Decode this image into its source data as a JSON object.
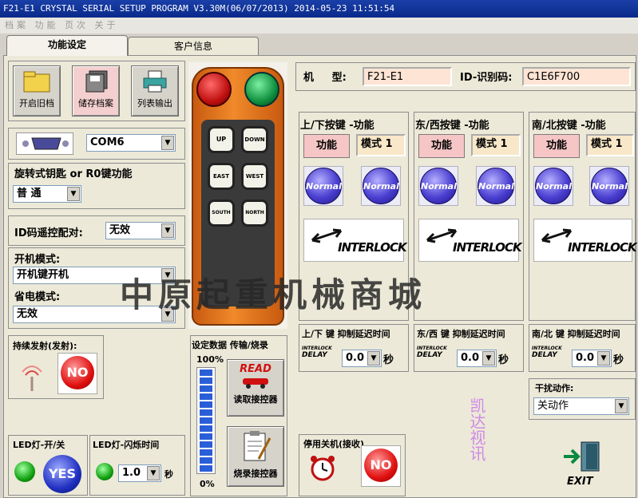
{
  "window": {
    "title": "F21-E1 CRYSTAL SERIAL SETUP PROGRAM V3.30M(06/07/2013)  2014-05-23  11:51:54"
  },
  "menu": {
    "items": [
      "档",
      "案",
      "功",
      "能",
      "页",
      "次",
      "关",
      "于"
    ]
  },
  "tabs": [
    {
      "label": "功能设定"
    },
    {
      "label": "客户信息"
    }
  ],
  "toolbar": {
    "open_label": "开启旧档",
    "save_label": "储存档案",
    "print_label": "列表输出"
  },
  "com": {
    "port": "COM6"
  },
  "key_switch": {
    "label": "旋转式钥匙 or R0键功能",
    "value": "普 通"
  },
  "id_pair": {
    "label": "ID码遥控配对:",
    "value": "无效"
  },
  "power_on": {
    "label": "开机模式:",
    "value": "开机键开机"
  },
  "power_save": {
    "label": "省电模式:",
    "value": "无效"
  },
  "continuous": {
    "label": "持续发射(发射):",
    "badge": "NO"
  },
  "led": {
    "on_label": "LED灯-开/关",
    "on_badge": "YES",
    "blink_label": "LED灯-闪烁时间",
    "blink_value": "1.0",
    "unit": "秒"
  },
  "remote": {
    "buttons": [
      "UP",
      "DOWN",
      "EAST",
      "WEST",
      "SOUTH",
      "NORTH"
    ]
  },
  "transfer": {
    "title": "设定数据 传输/烧录",
    "top_pct": "100%",
    "bottom_pct": "0%",
    "read_title": "READ",
    "read_label": "读取接控器",
    "write_label": "烧录接控器"
  },
  "model": {
    "label": "机     型:",
    "value": "F21-E1",
    "id_label": "ID-识别码:",
    "id_value": "C1E6F700"
  },
  "groups": [
    {
      "title": "上/下按键 -功能",
      "func": "功能",
      "mode": "模式 1",
      "normal": "Normal",
      "interlock": "INTERLOCK",
      "delay_title": "上/下 键 抑制延迟时间",
      "delay_value": "0.0",
      "unit": "秒"
    },
    {
      "title": "东/西按键 -功能",
      "func": "功能",
      "mode": "模式 1",
      "normal": "Normal",
      "interlock": "INTERLOCK",
      "delay_title": "东/西 键 抑制延迟时间",
      "delay_value": "0.0",
      "unit": "秒"
    },
    {
      "title": "南/北按键 -功能",
      "func": "功能",
      "mode": "模式 1",
      "normal": "Normal",
      "interlock": "INTERLOCK",
      "delay_title": "南/北 键 抑制延迟时间",
      "delay_value": "0.0",
      "unit": "秒"
    }
  ],
  "delay_badge": {
    "top": "INTERLOCK",
    "bottom": "DELAY"
  },
  "interference": {
    "label": "干扰动作:",
    "value": "关动作"
  },
  "shutdown": {
    "label": "停用关机(接收)",
    "badge": "NO"
  },
  "exit": {
    "label": "EXIT"
  },
  "watermark": {
    "text": "中原起重机械商城",
    "vertical": "凯达视讯"
  }
}
